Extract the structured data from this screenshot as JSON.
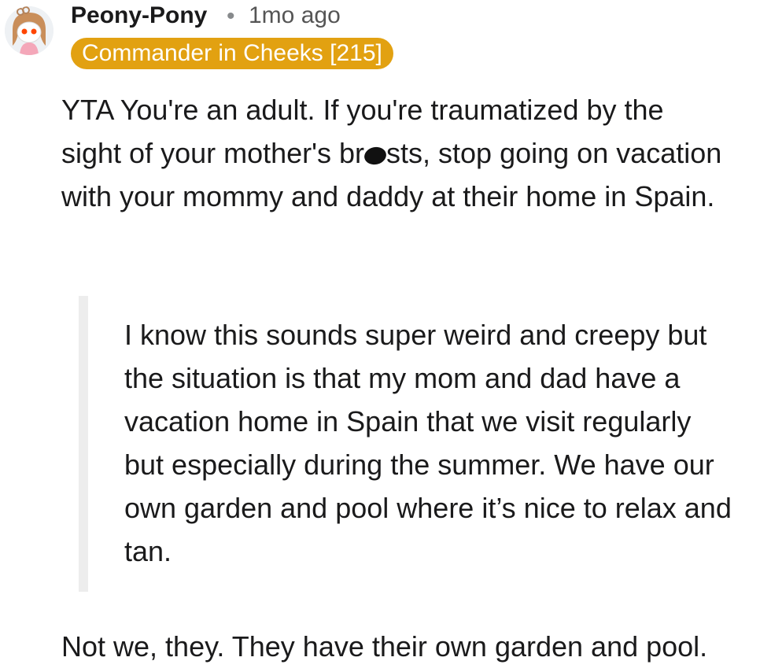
{
  "comment": {
    "username": "Peony-Pony",
    "separator": "•",
    "timestamp": "1mo ago",
    "flair": "Commander in Cheeks [215]",
    "body_before_censor": "YTA You're an adult. If you're traumatized by the sight of your mother's br",
    "body_after_censor": "sts, stop going on vacation with your mommy and daddy at their home in Spain.",
    "quote": "I know this sounds super weird and creepy but the situation is that my mom and dad have a vacation home in Spain that we visit regularly but especially during the summer. We have our own garden and pool where it’s nice to relax and tan.",
    "reply": "Not we, they. They have their own garden and pool."
  },
  "icons": {
    "avatar": "snoo-avatar-icon",
    "censor": "redaction-mark"
  },
  "colors": {
    "flair_bg": "#e2a111",
    "flair_text": "#ffffff",
    "quote_bar": "#ededed",
    "meta_text": "#878a8c"
  }
}
